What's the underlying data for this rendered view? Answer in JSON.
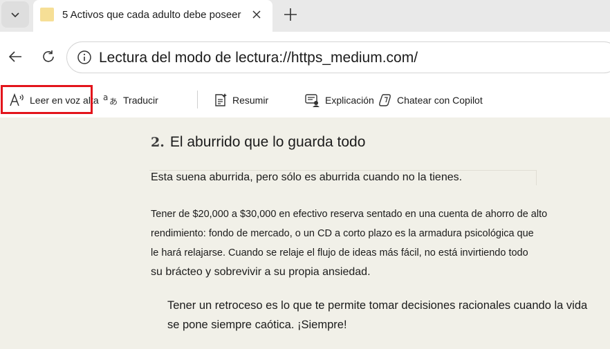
{
  "tab": {
    "title": "5 Activos que cada adulto debe poseer",
    "favicon_color": "#f6df96"
  },
  "address_bar": {
    "url": "Lectura del modo de lectura://https_medium.com/"
  },
  "reader_toolbar": {
    "read_aloud": "Leer en voz alta",
    "translate": "Traducir",
    "summarize": "Resumir",
    "explain": "Explicación",
    "chat": "Chatear con Copilot",
    "highlight_color": "#e3141b"
  },
  "article": {
    "heading_number": "2.",
    "heading_text": "El aburrido que lo guarda todo",
    "intro": "Esta suena aburrida, pero sólo es aburrida cuando no la tienes.",
    "paragraph_lines": [
      "Tener de $20,000 a $30,000 en efectivo reserva sentado en una cuenta de ahorro de alto",
      "rendimiento: fondo de mercado, o un CD a corto plazo es la armadura psicológica que",
      "le hará relajarse. Cuando se relaje el flujo de ideas más fácil, no está invirtiendo todo",
      "su brácteo y sobrevivir a su propia ansiedad."
    ],
    "quote_lines": [
      "Tener un retroceso es lo que te permite tomar decisiones racionales cuando la vida",
      "se pone siempre caótica. ¡Siempre!"
    ]
  },
  "theme": {
    "reading_background": "#f1f0e8",
    "tabstrip_background": "#e9e9e9"
  }
}
